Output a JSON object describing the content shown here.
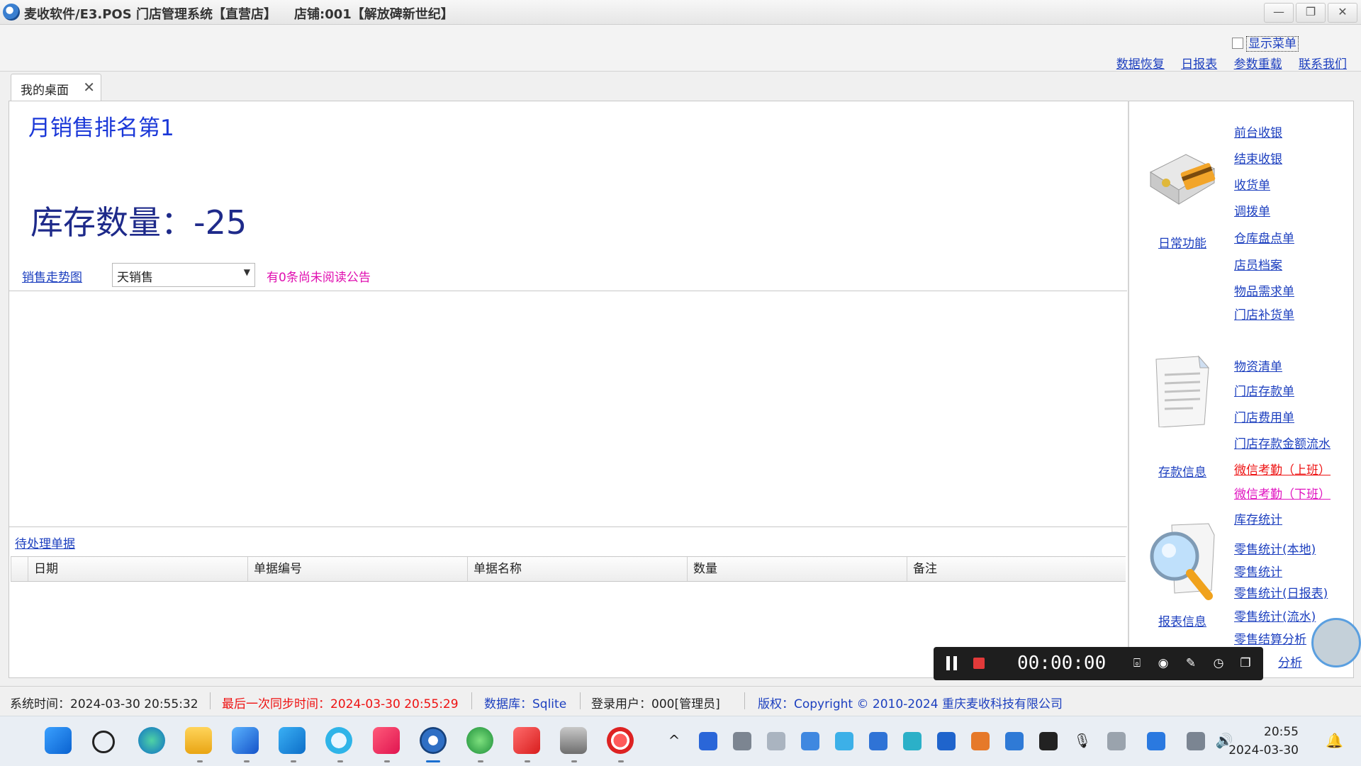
{
  "window": {
    "title": "麦收软件/E3.POS 门店管理系统【直营店】    店铺:001【解放碑新世纪】",
    "minimize": "—",
    "restore": "❐",
    "close": "✕"
  },
  "toolbar": {
    "show_menu": "显示菜单",
    "links": [
      "数据恢复",
      "日报表",
      "参数重载",
      "联系我们"
    ]
  },
  "tab": {
    "label": "我的桌面",
    "close": "✕"
  },
  "dashboard": {
    "rank_text": "月销售排名第1",
    "stock_text": "库存数量：-25",
    "trend_link": "销售走势图",
    "period_value": "天销售",
    "notice": "有0条尚未阅读公告",
    "pending_link": "待处理单据",
    "grid_columns": [
      "日期",
      "单据编号",
      "单据名称",
      "数量",
      "备注"
    ]
  },
  "sidebar": {
    "groups": [
      {
        "caption": "日常功能",
        "icon": "pos-register-icon",
        "links": [
          "前台收银",
          "结束收银",
          "收货单",
          "调拨单",
          "仓库盘点单",
          "店员档案",
          "物品需求单",
          "门店补货单"
        ]
      },
      {
        "caption": "存款信息",
        "icon": "document-icon",
        "links": [
          "物资清单",
          "门店存款单",
          "门店费用单",
          "门店存款金额流水",
          "微信考勤（上班）",
          "微信考勤（下班）",
          "库存统计"
        ]
      },
      {
        "caption": "报表信息",
        "icon": "magnifier-report-icon",
        "links": [
          "零售统计(本地)",
          "零售统计",
          "零售统计(日报表)",
          "零售统计(流水)",
          "零售结算分析",
          "分析"
        ]
      }
    ]
  },
  "recorder": {
    "time": "00:00:00"
  },
  "statusbar": {
    "system_time": "系统时间：2024-03-30 20:55:32",
    "last_sync": "最后一次同步时间：2024-03-30 20:55:29",
    "database": "数据库：Sqlite",
    "login_user": "登录用户：000[管理员]",
    "copyright": "版权：Copyright © 2010-2024 重庆麦收科技有限公司"
  },
  "taskbar": {
    "time": "20:55",
    "date": "2024-03-30"
  },
  "colors": {
    "link": "#1c3fbf",
    "rank": "#1b38d8",
    "notice": "#e00fb0",
    "warn": "#e11111"
  }
}
